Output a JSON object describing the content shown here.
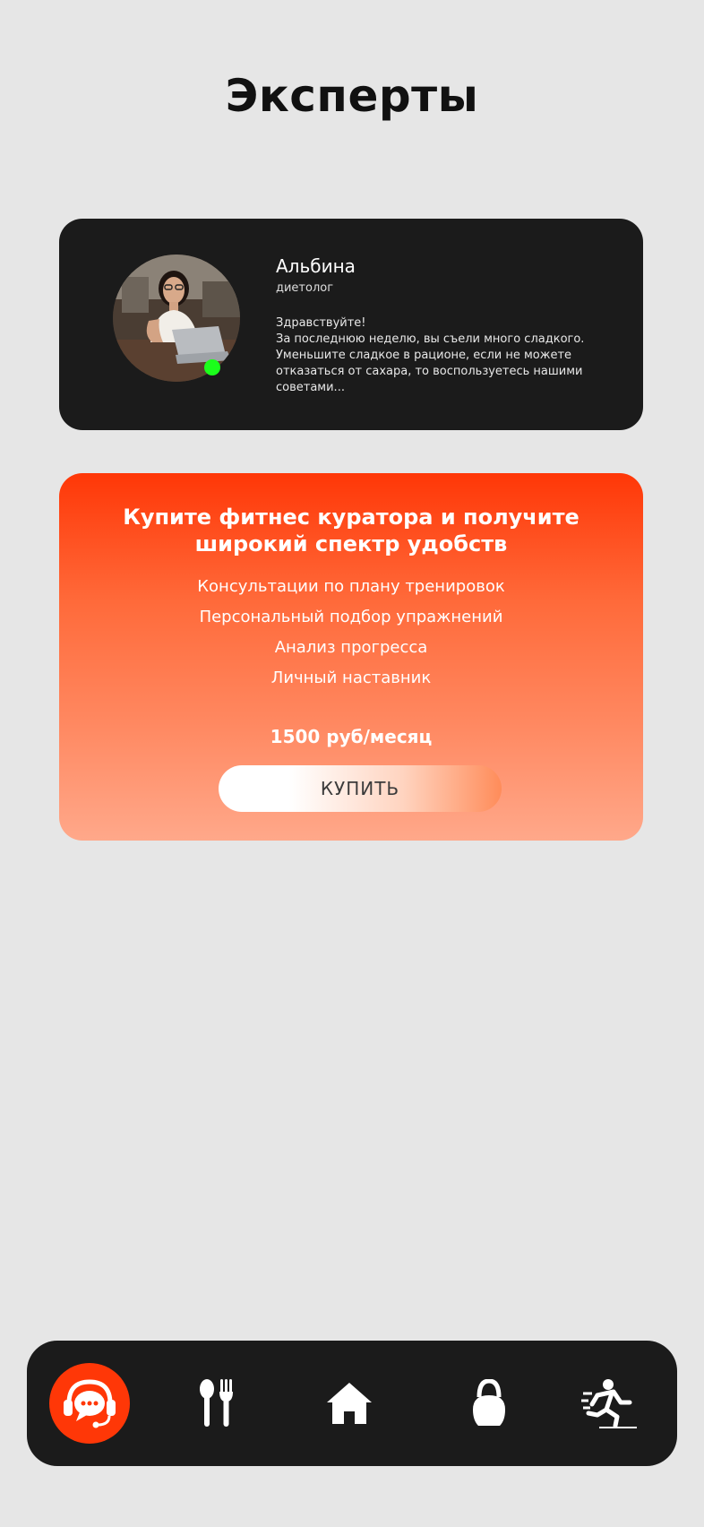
{
  "header": {
    "title": "Эксперты"
  },
  "expert": {
    "name": "Альбина",
    "role": "диетолог",
    "status": "online",
    "status_color": "#1bff1b",
    "message_greeting": "Здравствуйте!",
    "message_body": "За последнюю неделю, вы съели много сладкого. Уменьшите сладкое в рационе, если не можете отказаться от сахара, то воспользуетесь нашими советами..."
  },
  "promo": {
    "title": "Купите фитнес куратора и получите широкий спектр удобств",
    "benefits": [
      "Консультации по плану тренировок",
      "Персональный подбор упражнений",
      "Анализ прогресса",
      "Личный наставник"
    ],
    "price": "1500 руб/месяц",
    "buy_label": "КУПИТЬ",
    "accent_color": "#ff3707"
  },
  "nav": {
    "items": [
      {
        "icon": "support-chat-icon",
        "active": true
      },
      {
        "icon": "spoon-fork-icon",
        "active": false
      },
      {
        "icon": "home-icon",
        "active": false
      },
      {
        "icon": "kettlebell-icon",
        "active": false
      },
      {
        "icon": "running-icon",
        "active": false
      }
    ]
  }
}
